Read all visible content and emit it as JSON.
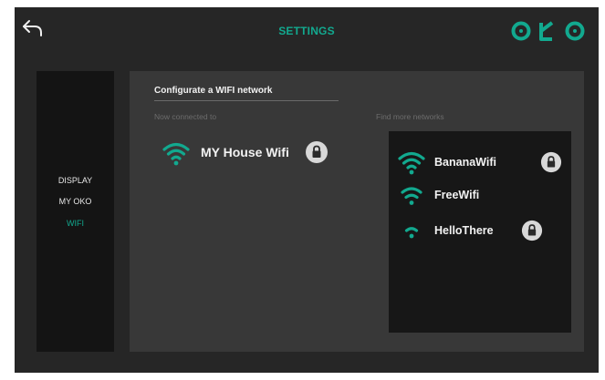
{
  "header": {
    "title": "SETTINGS",
    "logo_text": "OKO",
    "accent_color": "#12a98f",
    "back_icon": "back-arrow-icon"
  },
  "sidebar": {
    "items": [
      {
        "label": "DISPLAY",
        "active": false
      },
      {
        "label": "MY OKO",
        "active": false
      },
      {
        "label": "WIFI",
        "active": true
      }
    ]
  },
  "wifi": {
    "section_title": "Configurate a WIFI network",
    "connected_label": "Now connected to",
    "connected_network": {
      "name": "MY House Wifi",
      "locked": true,
      "signal_bars": 3
    },
    "find_label": "Find more networks",
    "networks": [
      {
        "name": "BananaWifi",
        "locked": true,
        "signal_bars": 3
      },
      {
        "name": "FreeWifi",
        "locked": false,
        "signal_bars": 2
      },
      {
        "name": "HelloThere",
        "locked": true,
        "signal_bars": 1
      }
    ]
  }
}
